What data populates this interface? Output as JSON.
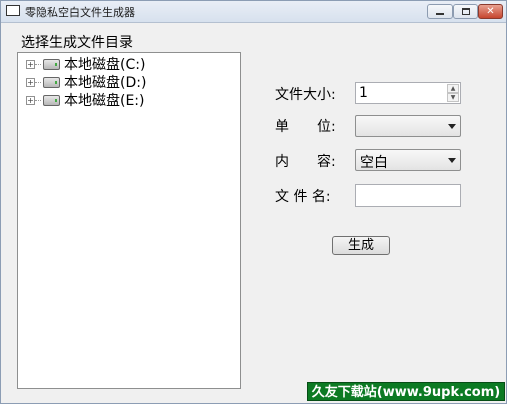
{
  "window": {
    "title": "零隐私空白文件生成器"
  },
  "tree": {
    "group_label": "选择生成文件目录",
    "items": [
      {
        "label": "本地磁盘(C:)"
      },
      {
        "label": "本地磁盘(D:)"
      },
      {
        "label": "本地磁盘(E:)"
      }
    ]
  },
  "form": {
    "size_label": "文件大小:",
    "size_value": "1",
    "unit_label": "单　　位:",
    "unit_value": "",
    "content_label": "内　　容:",
    "content_value": "空白",
    "filename_label": "文 件 名:",
    "filename_value": "",
    "generate_button": "生成"
  },
  "watermark": {
    "text": "久友下载站(www.9upk.com)"
  },
  "colors": {
    "watermark_bg": "#0c7a23",
    "close_button": "#c6452f"
  }
}
